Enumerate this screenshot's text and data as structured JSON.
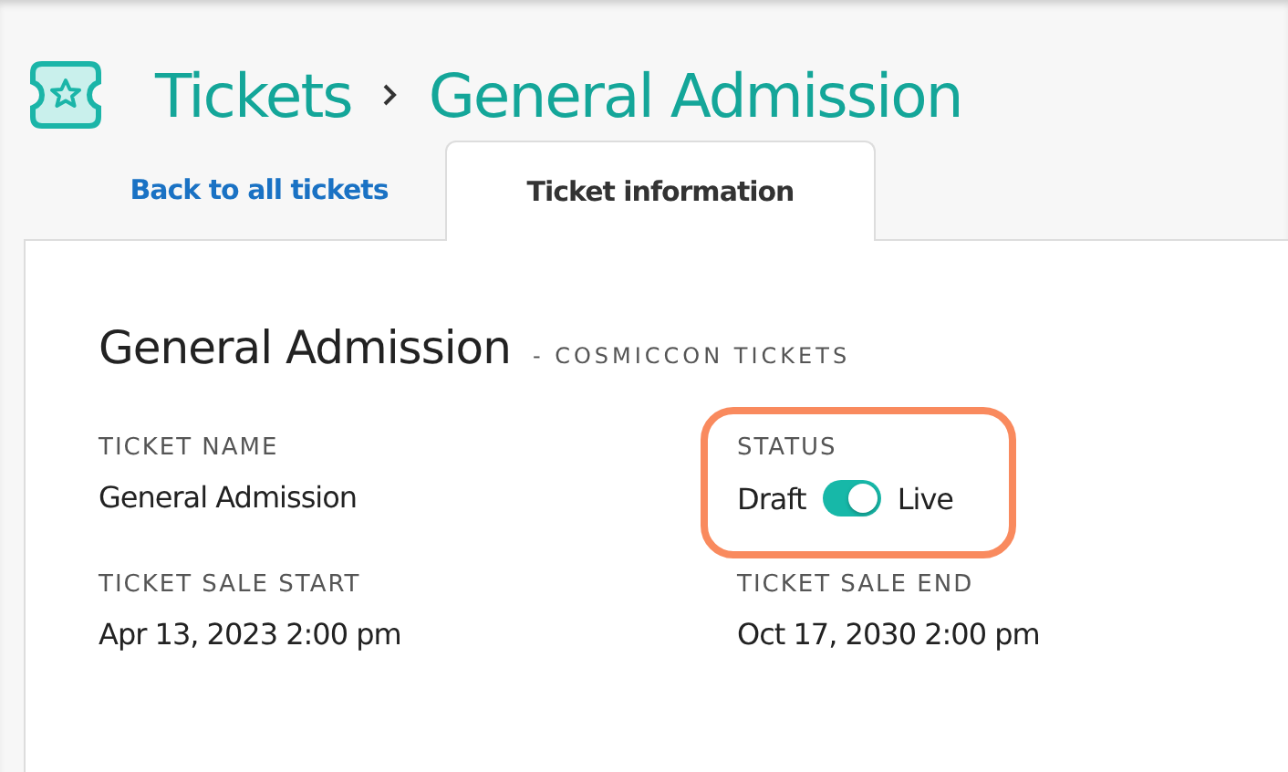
{
  "breadcrumb": [
    {
      "label": "Tickets"
    },
    {
      "label": "General Admission"
    }
  ],
  "tabs": [
    {
      "label": "Back to all tickets",
      "selected": false
    },
    {
      "label": "Ticket information",
      "selected": true
    }
  ],
  "card": {
    "title": "General Admission",
    "subtitle": "- COSMICCON TICKETS",
    "fields": [
      {
        "kind": "text",
        "label": "TICKET NAME",
        "value": "General Admission",
        "highlighted": false
      },
      {
        "kind": "toggle",
        "label": "STATUS",
        "off_label": "Draft",
        "on_label": "Live",
        "on": true,
        "highlighted": true
      },
      {
        "kind": "text",
        "label": "TICKET SALE START",
        "value": "Apr 13, 2023 2:00 pm",
        "highlighted": false
      },
      {
        "kind": "text",
        "label": "TICKET SALE END",
        "value": "Oct 17, 2030 2:00 pm",
        "highlighted": false
      }
    ]
  }
}
